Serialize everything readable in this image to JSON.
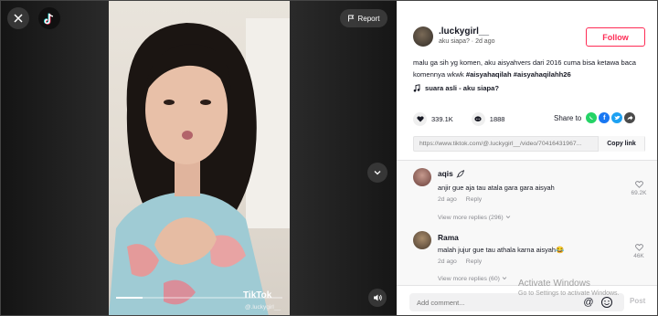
{
  "video": {
    "report_label": "Report",
    "watermark": "TikTok",
    "watermark_user": "@.luckygirl__",
    "progress": 0.16
  },
  "author": {
    "name": ".luckygirl__",
    "subtitle": "aku siapa? · 2d ago",
    "follow_label": "Follow"
  },
  "caption": {
    "text": "malu ga sih yg komen, aku aisyahvers dari 2016 cuma bisa ketawa baca komennya wkwk",
    "hashtag1": "#aisyahaqilah",
    "hashtag2": "#aisyahaqilahh26"
  },
  "music": "suara asli - aku siapa?",
  "stats": {
    "likes": "339.1K",
    "comments": "1888",
    "share_label": "Share to"
  },
  "link": {
    "url": "https://www.tiktok.com/@.luckygirl__/video/70416431967...",
    "copy_label": "Copy link"
  },
  "comments": [
    {
      "name": "aqis",
      "text": "anjir gue aja tau atala gara gara aisyah",
      "time": "2d ago",
      "reply_label": "Reply",
      "likes": "69.2K",
      "view_replies": "View more replies (296)"
    },
    {
      "name": "Rama",
      "text": "malah jujur gue tau athala karna aisyah😂",
      "time": "2d ago",
      "reply_label": "Reply",
      "likes": "46K",
      "view_replies": "View more replies (60)"
    }
  ],
  "footer": {
    "placeholder": "Add comment...",
    "post_label": "Post",
    "activate_title": "Activate Windows",
    "activate_sub": "Go to Settings to activate Windows."
  },
  "colors": {
    "accent": "#fe2c55",
    "whatsapp": "#25d366",
    "facebook": "#1877f2",
    "twitter": "#1da1f2",
    "more": "#4a4a4a"
  }
}
